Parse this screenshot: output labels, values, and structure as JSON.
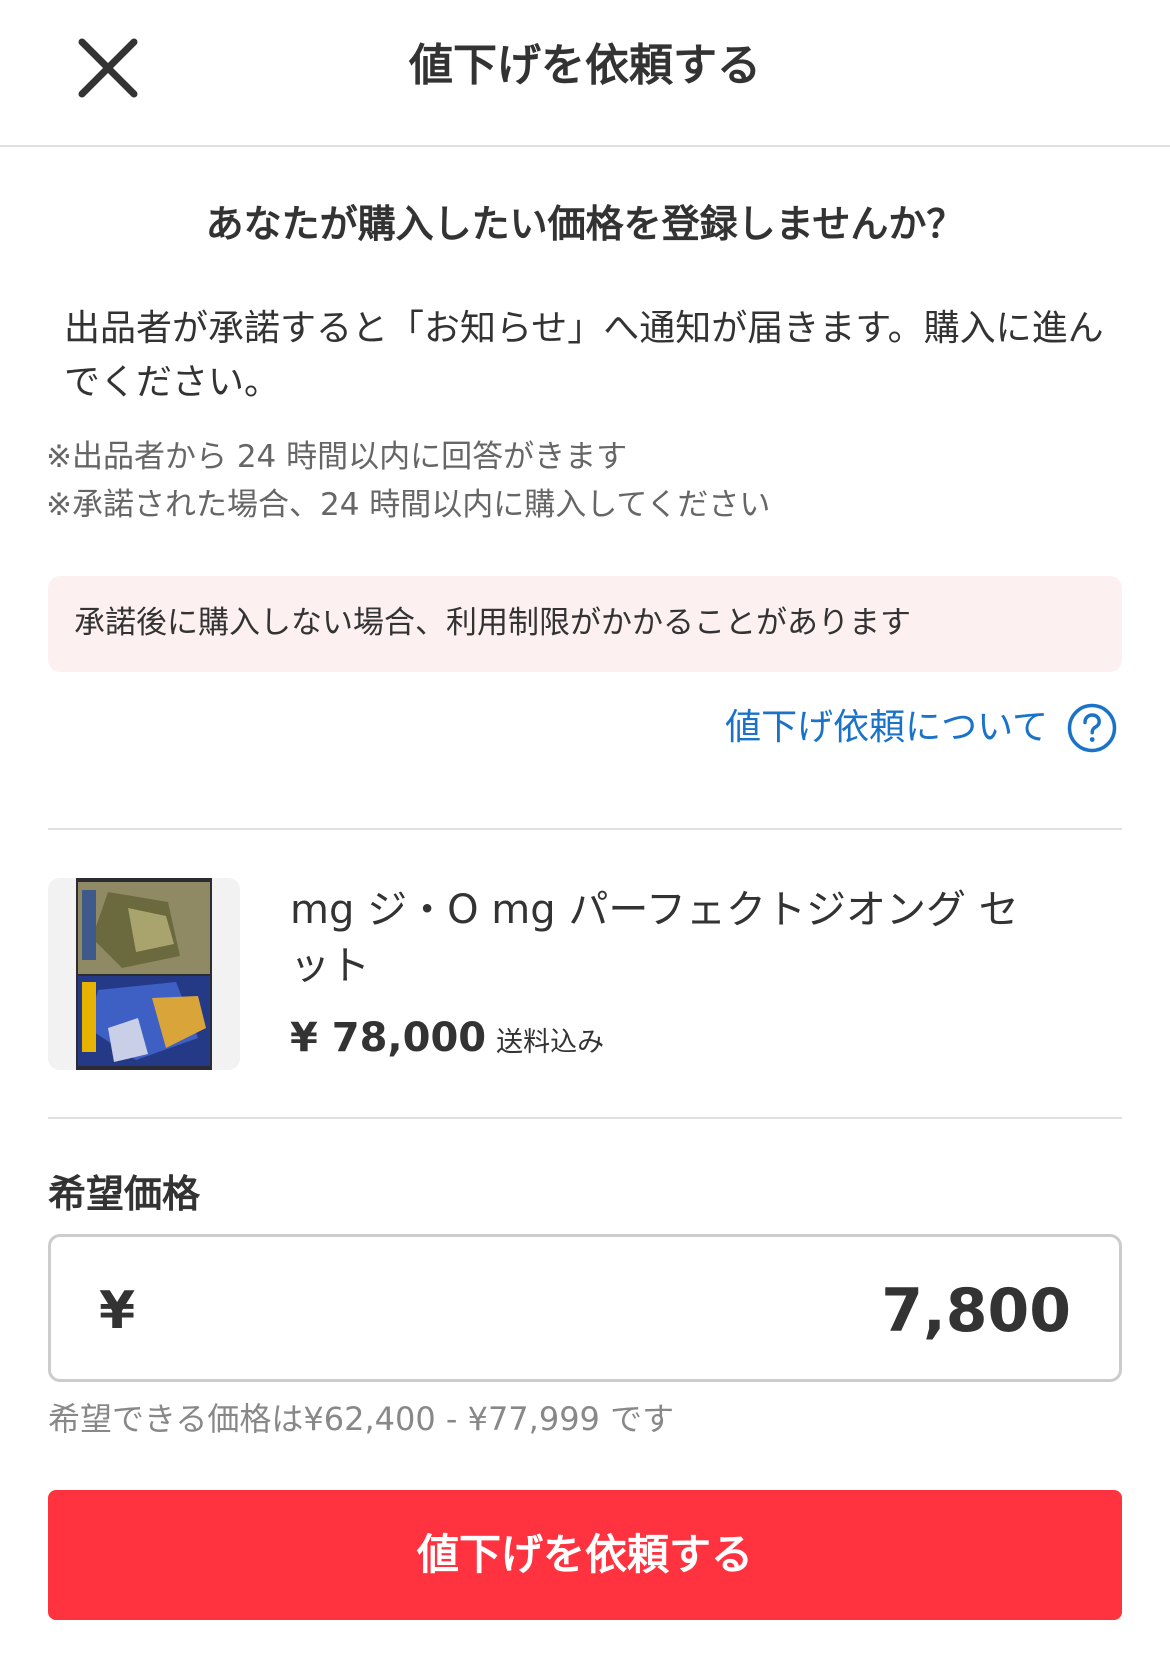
{
  "header": {
    "title": "値下げを依頼する",
    "close_icon": "close-icon"
  },
  "intro": {
    "lead": "あなたが購入したい価格を登録しませんか？",
    "description": "出品者が承諾すると「お知らせ」へ通知が届きます。購入に進んでください。",
    "note_1": "※出品者から 24 時間以内に回答がきます",
    "note_2": "※承諾された場合、24 時間以内に購入してください"
  },
  "warning": {
    "text": "承諾後に購入しない場合、利用制限がかかることがあります",
    "background": "#fdf0f1"
  },
  "help": {
    "label": "値下げ依頼について",
    "icon": "question-circle-icon",
    "color": "#1a73c8"
  },
  "item": {
    "name": "mg ジ・O mg パーフェクトジオング セット",
    "price": "¥ 78,000",
    "shipping": "送料込み",
    "thumbnail_icon": "product-thumbnail-image"
  },
  "price_field": {
    "label": "希望価格",
    "currency": "¥",
    "value": "7,800",
    "range_hint": "希望できる価格は¥62,400 - ¥77,999 です"
  },
  "submit": {
    "label": "値下げを依頼する",
    "color": "#ff333f"
  }
}
